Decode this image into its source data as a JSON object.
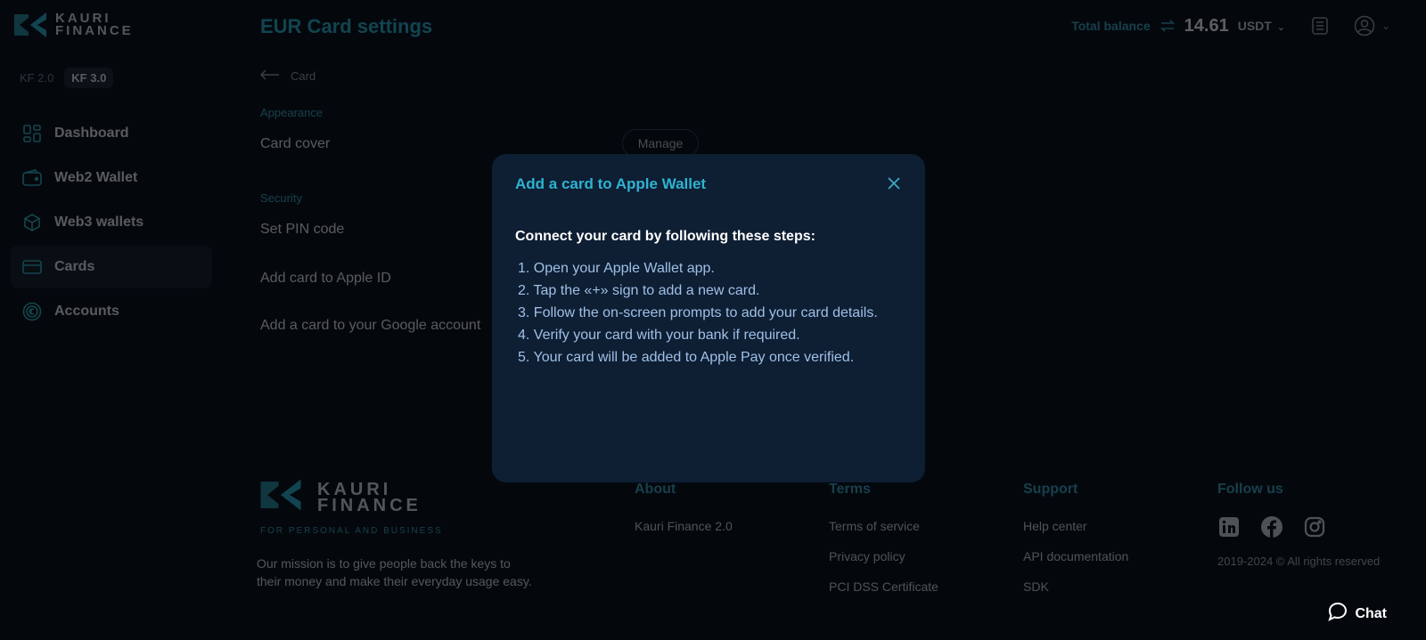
{
  "brand": {
    "name_line1": "KAURI",
    "name_line2": "FINANCE",
    "accent": "#2fb3d1"
  },
  "versions": [
    {
      "label": "KF 2.0"
    },
    {
      "label": "KF 3.0",
      "active": true
    }
  ],
  "sidebar": {
    "items": [
      {
        "label": "Dashboard",
        "icon": "dashboard-icon"
      },
      {
        "label": "Web2 Wallet",
        "icon": "wallet-icon"
      },
      {
        "label": "Web3 wallets",
        "icon": "cube-icon"
      },
      {
        "label": "Cards",
        "icon": "card-icon",
        "active": true
      },
      {
        "label": "Accounts",
        "icon": "euro-icon"
      }
    ]
  },
  "header": {
    "title": "EUR Card settings",
    "balance_label": "Total balance",
    "balance_value": "14.61",
    "currency": "USDT"
  },
  "content": {
    "back_label": "Card",
    "appearance_label": "Appearance",
    "card_cover": "Card cover",
    "manage": "Manage",
    "security_label": "Security",
    "set_pin": "Set PIN code",
    "apple_id": "Add card to Apple ID",
    "google": "Add a card to your Google account"
  },
  "footer": {
    "tagline": "FOR PERSONAL AND BUSINESS",
    "mission": "Our mission is to give people back the keys to their money and make their everyday usage easy.",
    "about": {
      "title": "About",
      "links": [
        "Kauri Finance 2.0"
      ]
    },
    "terms": {
      "title": "Terms",
      "links": [
        "Terms of service",
        "Privacy policy",
        "PCI DSS Certificate"
      ]
    },
    "support": {
      "title": "Support",
      "links": [
        "Help center",
        "API documentation",
        "SDK"
      ]
    },
    "follow": {
      "title": "Follow us",
      "copyright": "2019-2024 © All rights reserved"
    },
    "chat": "Chat"
  },
  "modal": {
    "title": "Add a card to Apple Wallet",
    "heading": "Connect your card by following these steps:",
    "steps": [
      "1. Open your Apple Wallet app.",
      "2. Tap the «+» sign to add a new card.",
      "3. Follow the on-screen prompts to add your card details.",
      "4. Verify your card with your bank if required.",
      "5. Your card will be added to Apple Pay once verified."
    ]
  }
}
